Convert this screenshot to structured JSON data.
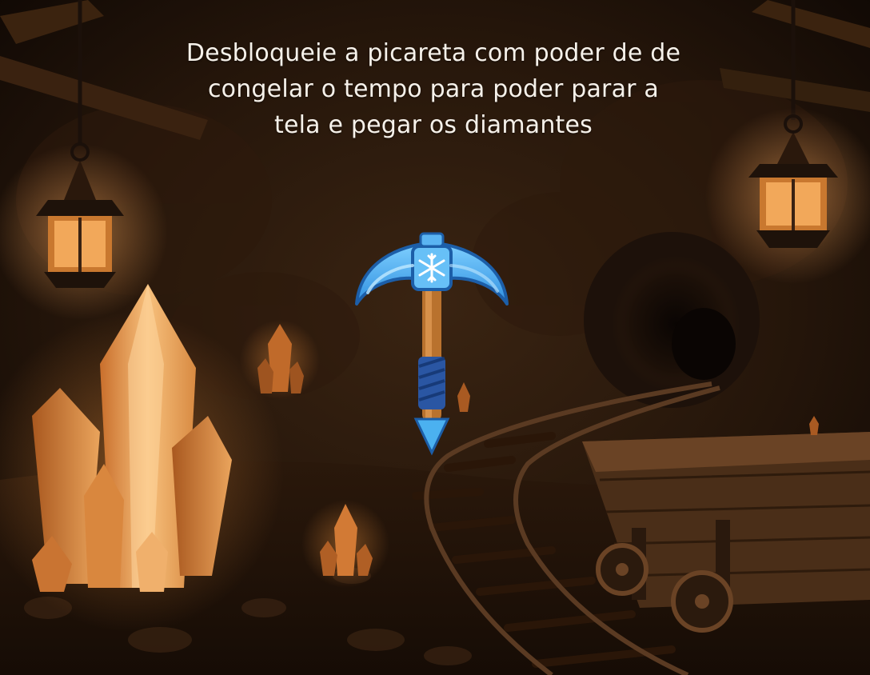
{
  "screen": {
    "message_lines": [
      "Desbloqueie a picareta com poder de de",
      "congelar o tempo para poder parar a",
      "tela e pegar os diamantes"
    ]
  },
  "items": {
    "pickaxe": {
      "name": "ice-pickaxe",
      "power": "freeze-time",
      "icon": "snowflake-icon",
      "color": "#3fa4ec"
    }
  },
  "theme": {
    "accent": "#e8a35a",
    "background": "#1a0f08",
    "text": "#f6f1ea"
  }
}
